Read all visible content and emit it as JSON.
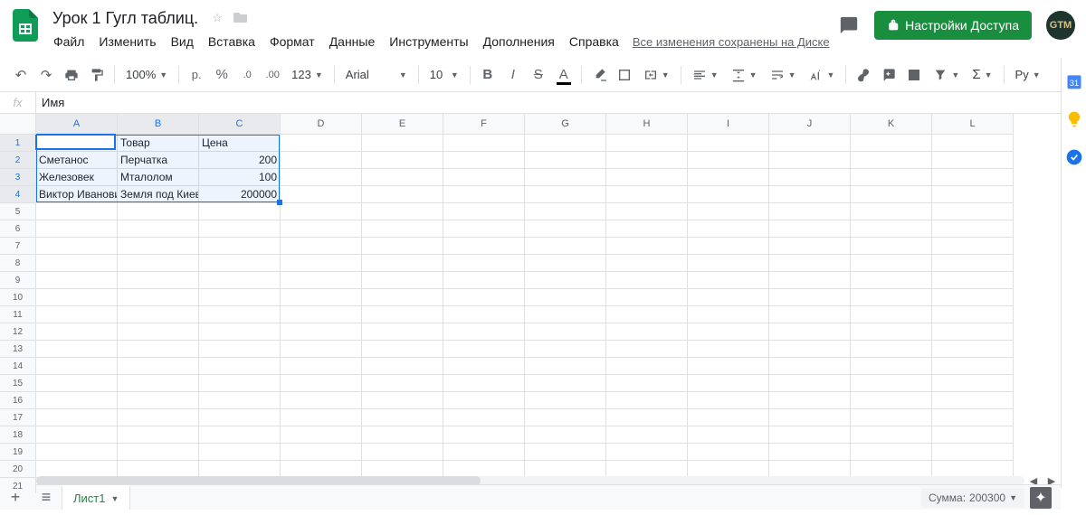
{
  "doc": {
    "title": "Урок 1 Гугл таблиц."
  },
  "menu": {
    "file": "Файл",
    "edit": "Изменить",
    "view": "Вид",
    "insert": "Вставка",
    "format": "Формат",
    "data": "Данные",
    "tools": "Инструменты",
    "addons": "Дополнения",
    "help": "Справка",
    "saved": "Все изменения сохранены на Диске"
  },
  "header": {
    "share": "Настройки Доступа",
    "avatar": "GTM"
  },
  "toolbar": {
    "zoom": "100%",
    "currency": "р.",
    "font": "Arial",
    "fontsize": "10",
    "lang": "Ру"
  },
  "formula": {
    "fx": "fx",
    "value": "Имя"
  },
  "columns": [
    "A",
    "B",
    "C",
    "D",
    "E",
    "F",
    "G",
    "H",
    "I",
    "J",
    "K",
    "L"
  ],
  "rows": 22,
  "data": [
    [
      "Имя",
      "Товар",
      "Цена"
    ],
    [
      "Сметанос",
      "Перчатка",
      "200"
    ],
    [
      "Железовек",
      "Мталолом",
      "100"
    ],
    [
      "Виктор Иванови",
      "Земля под Киев",
      "200000"
    ]
  ],
  "numeric_cols": [
    2
  ],
  "selection": {
    "r1": 0,
    "c1": 0,
    "r2": 3,
    "c2": 2,
    "active_r": 0,
    "active_c": 0
  },
  "sheet": {
    "name": "Лист1"
  },
  "status": {
    "sum_label": "Сумма:",
    "sum_value": "200300"
  }
}
